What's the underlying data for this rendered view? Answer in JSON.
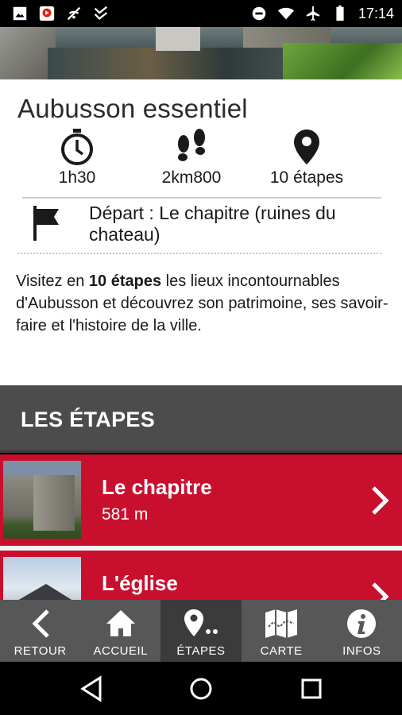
{
  "status_bar": {
    "time": "17:14",
    "icons": [
      "image-icon",
      "youtube-icon",
      "no-signal-icon",
      "check-icon",
      "dnd-icon",
      "wifi-icon",
      "airplane-icon",
      "battery-icon"
    ]
  },
  "tour": {
    "title": "Aubusson essentiel",
    "stats": {
      "duration": "1h30",
      "distance": "2km800",
      "steps": "10 étapes"
    },
    "depart": "Départ : Le chapitre (ruines du chateau)",
    "description_prefix": "Visitez en ",
    "description_bold": "10 étapes",
    "description_suffix": " les lieux incontournables d'Aubusson et découvrez son patrimoine, ses savoir-faire et l'histoire de la ville."
  },
  "section": {
    "label": "LES ÉTAPES"
  },
  "steps": [
    {
      "name": "Le chapitre",
      "distance": "581 m"
    },
    {
      "name": "L'église",
      "distance": ""
    }
  ],
  "tabbar": {
    "tabs": [
      {
        "label": "RETOUR",
        "icon": "chevron-left-icon"
      },
      {
        "label": "ACCUEIL",
        "icon": "house-icon"
      },
      {
        "label": "ÉTAPES",
        "icon": "map-pin-dots-icon"
      },
      {
        "label": "CARTE",
        "icon": "folded-map-icon"
      },
      {
        "label": "INFOS",
        "icon": "info-icon"
      }
    ],
    "active_index": 2
  },
  "colors": {
    "accent_red": "#c8102e",
    "section_gray": "#4c4c4c",
    "tabbar_gray": "#575757",
    "tab_active": "#3b3b3b"
  }
}
